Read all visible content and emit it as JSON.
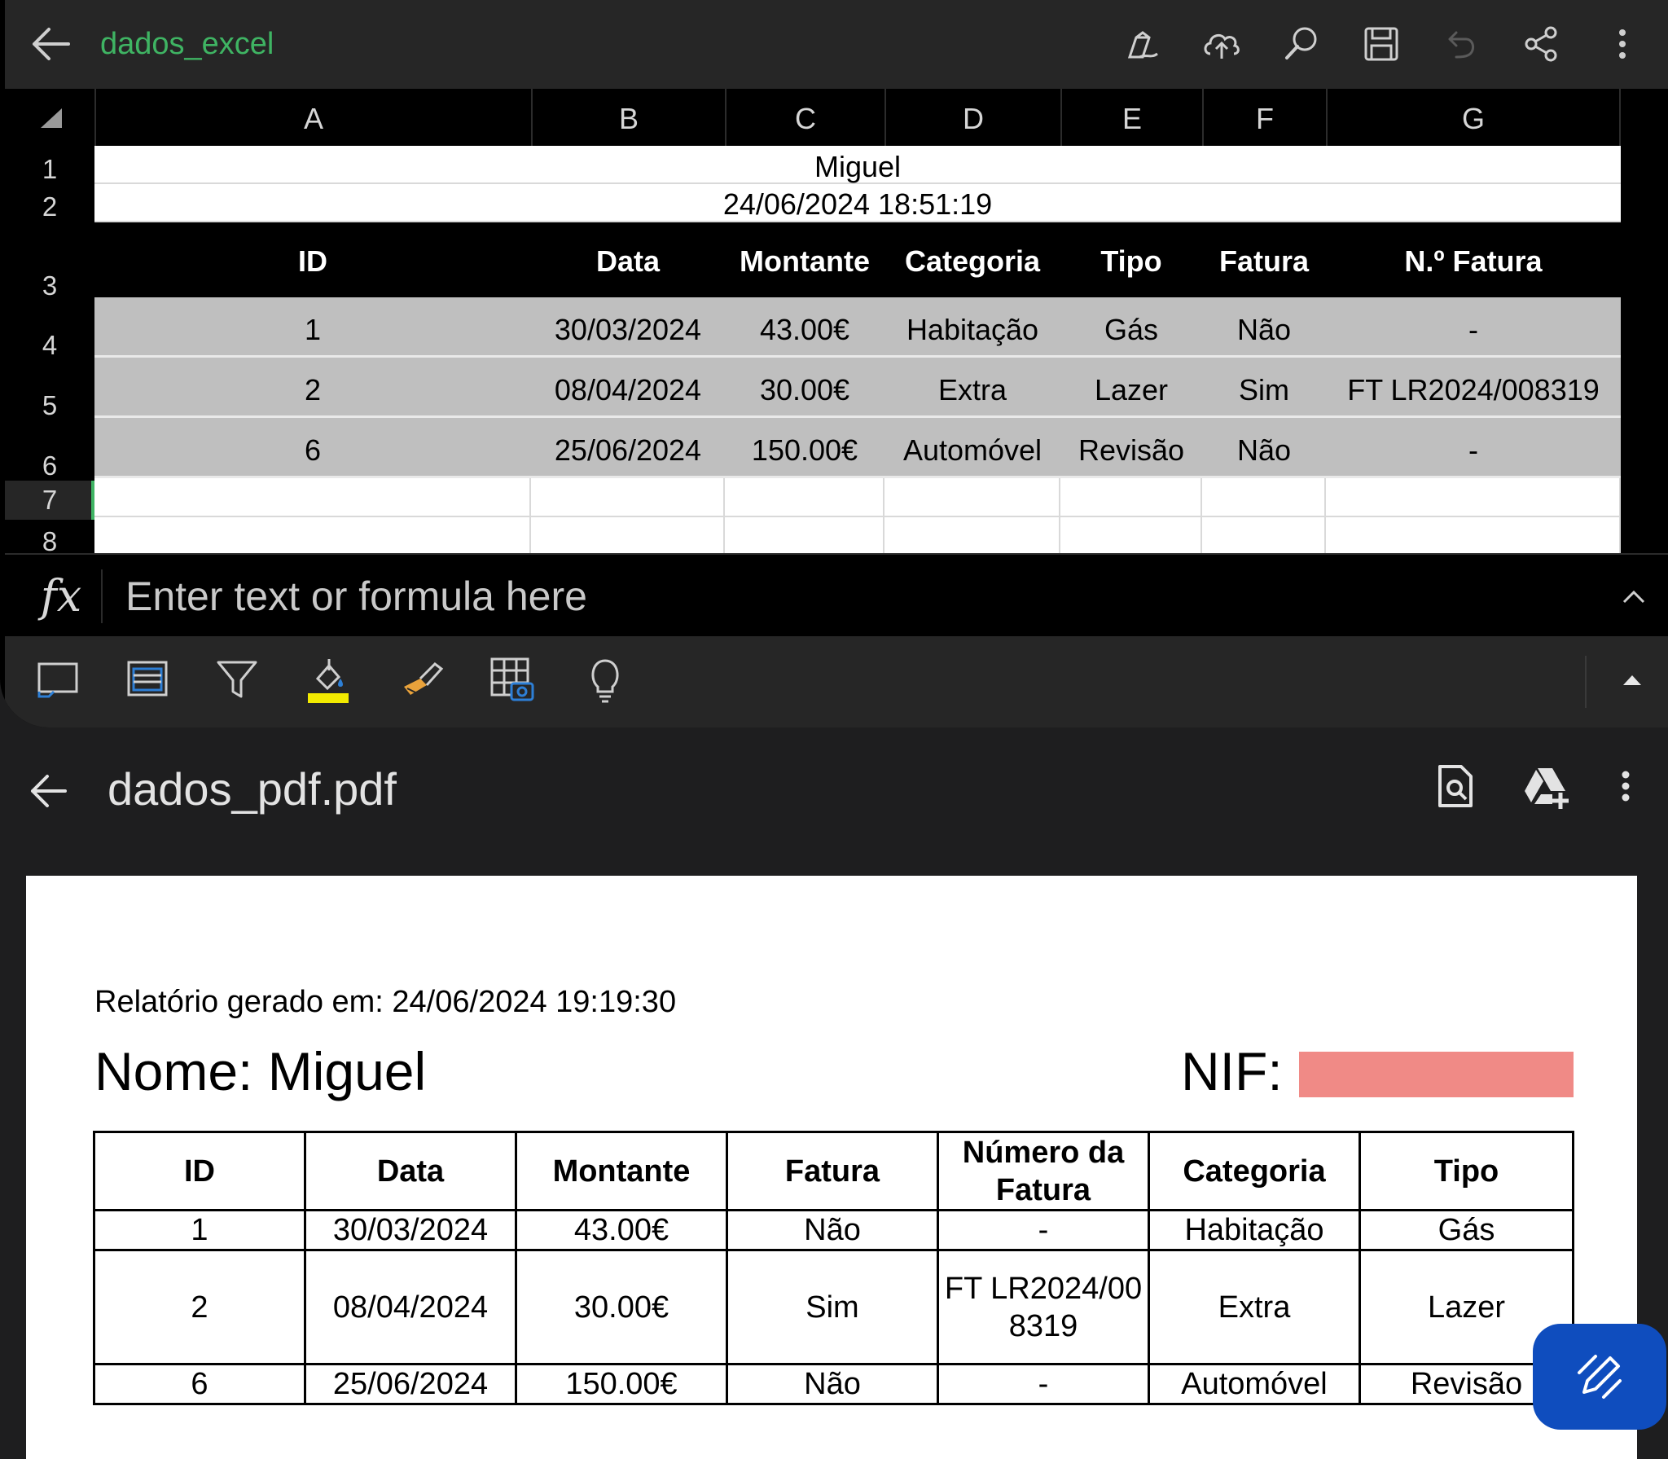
{
  "excel": {
    "file_name": "dados_excel",
    "toolbar_icons": [
      "draw-pen-icon",
      "cloud-upload-icon",
      "search-icon",
      "save-icon",
      "undo-icon",
      "share-icon",
      "more-vert-icon"
    ],
    "columns": [
      "A",
      "B",
      "C",
      "D",
      "E",
      "F",
      "G"
    ],
    "row_numbers": [
      "1",
      "2",
      "3",
      "4",
      "5",
      "6",
      "7",
      "8"
    ],
    "title_cell": "Miguel",
    "timestamp_cell": "24/06/2024 18:51:19",
    "headers": [
      "ID",
      "Data",
      "Montante",
      "Categoria",
      "Tipo",
      "Fatura",
      "N.º Fatura"
    ],
    "rows": [
      [
        "1",
        "30/03/2024",
        "43.00€",
        "Habitação",
        "Gás",
        "Não",
        "-"
      ],
      [
        "2",
        "08/04/2024",
        "30.00€",
        "Extra",
        "Lazer",
        "Sim",
        "FT LR2024/008319"
      ],
      [
        "6",
        "25/06/2024",
        "150.00€",
        "Automóvel",
        "Revisão",
        "Não",
        "-"
      ]
    ],
    "formula_symbol": "fx",
    "formula_placeholder": "Enter text or formula here",
    "ribbon_icons": [
      "view-icon",
      "freeze-panes-icon",
      "filter-icon",
      "fill-color-icon",
      "format-painter-icon",
      "table-camera-icon",
      "ideas-bulb-icon"
    ],
    "accent_color": "#3fb463",
    "fill_color_swatch": "#f2ea00"
  },
  "pdf": {
    "file_name": "dados_pdf.pdf",
    "toolbar_icons": [
      "find-in-page-icon",
      "drive-add-icon",
      "more-vert-icon"
    ],
    "report_generated": "Relatório gerado em: 24/06/2024 19:19:30",
    "name_line": "Nome: Miguel",
    "nif_label": "NIF:",
    "headers": [
      "ID",
      "Data",
      "Montante",
      "Fatura",
      "Número da Fatura",
      "Categoria",
      "Tipo"
    ],
    "rows": [
      [
        "1",
        "30/03/2024",
        "43.00€",
        "Não",
        "-",
        "Habitação",
        "Gás"
      ],
      [
        "2",
        "08/04/2024",
        "30.00€",
        "Sim",
        "FT LR2024/008319",
        "Extra",
        "Lazer"
      ],
      [
        "6",
        "25/06/2024",
        "150.00€",
        "Não",
        "-",
        "Automóvel",
        "Revisão"
      ]
    ],
    "redaction_color": "#f08a86",
    "fab_color": "#0f4dbe"
  }
}
